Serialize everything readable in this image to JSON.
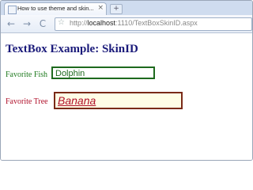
{
  "browser": {
    "tab_title": "How to use theme and skin...",
    "tab_close": "×",
    "new_tab": "+",
    "back_glyph": "←",
    "forward_glyph": "→",
    "reload_glyph": "C",
    "star_glyph": "☆",
    "url_scheme": "http://",
    "url_host": "localhost",
    "url_rest": ":1110/TextBoxSkinID.aspx"
  },
  "page": {
    "heading": "TextBox Example: SkinID",
    "fish_label": "Favorite Fish",
    "fish_value": "Dolphin",
    "tree_label": "Favorite Tree",
    "tree_value": "Banana"
  }
}
